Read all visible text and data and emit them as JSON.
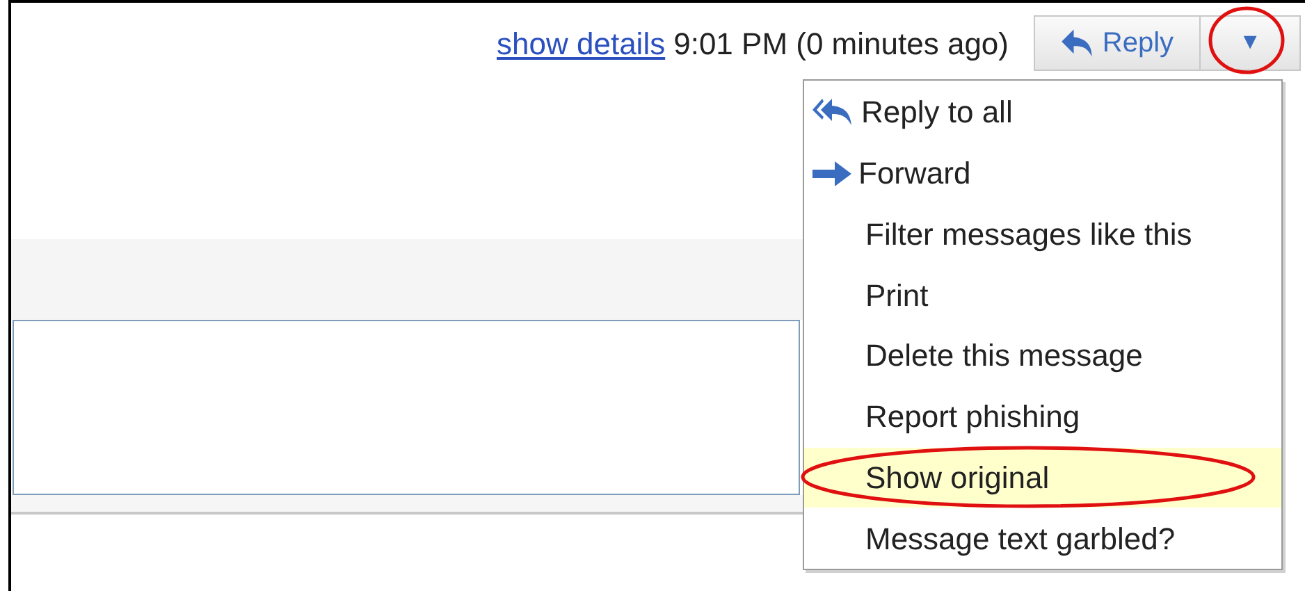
{
  "header": {
    "details_link": "show details",
    "time": "9:01 PM (0 minutes ago)"
  },
  "reply_button": {
    "label": "Reply"
  },
  "more_button": {
    "label": "▼",
    "circled": true
  },
  "menu": {
    "items": [
      {
        "kind": "replyall",
        "label": "Reply to all",
        "selected": false,
        "circled": false
      },
      {
        "kind": "forward",
        "label": "Forward",
        "selected": false,
        "circled": false
      },
      {
        "kind": "plain",
        "label": "Filter messages like this",
        "selected": false,
        "circled": false
      },
      {
        "kind": "plain",
        "label": "Print",
        "selected": false,
        "circled": false
      },
      {
        "kind": "plain",
        "label": "Delete this message",
        "selected": false,
        "circled": false
      },
      {
        "kind": "plain",
        "label": "Report phishing",
        "selected": false,
        "circled": false
      },
      {
        "kind": "plain",
        "label": "Show original",
        "selected": true,
        "circled": true
      },
      {
        "kind": "plain",
        "label": "Message text garbled?",
        "selected": false,
        "circled": false
      }
    ]
  }
}
